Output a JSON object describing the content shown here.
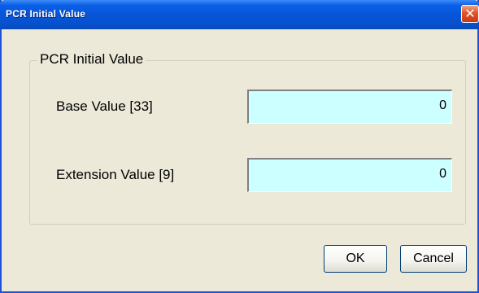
{
  "window": {
    "title": "PCR Initial Value"
  },
  "group": {
    "legend": "PCR Initial Value"
  },
  "fields": {
    "base_label": "Base Value [33]",
    "base_value": "0",
    "extension_label": "Extension Value [9]",
    "extension_value": "0"
  },
  "buttons": {
    "ok_label": "OK",
    "cancel_label": "Cancel"
  },
  "icons": {
    "close": "close-icon"
  },
  "colors": {
    "titlebar": "#0756d8",
    "input_background": "#ccffff",
    "dialog_background": "#ece9d8",
    "close_button": "#e0542a"
  }
}
